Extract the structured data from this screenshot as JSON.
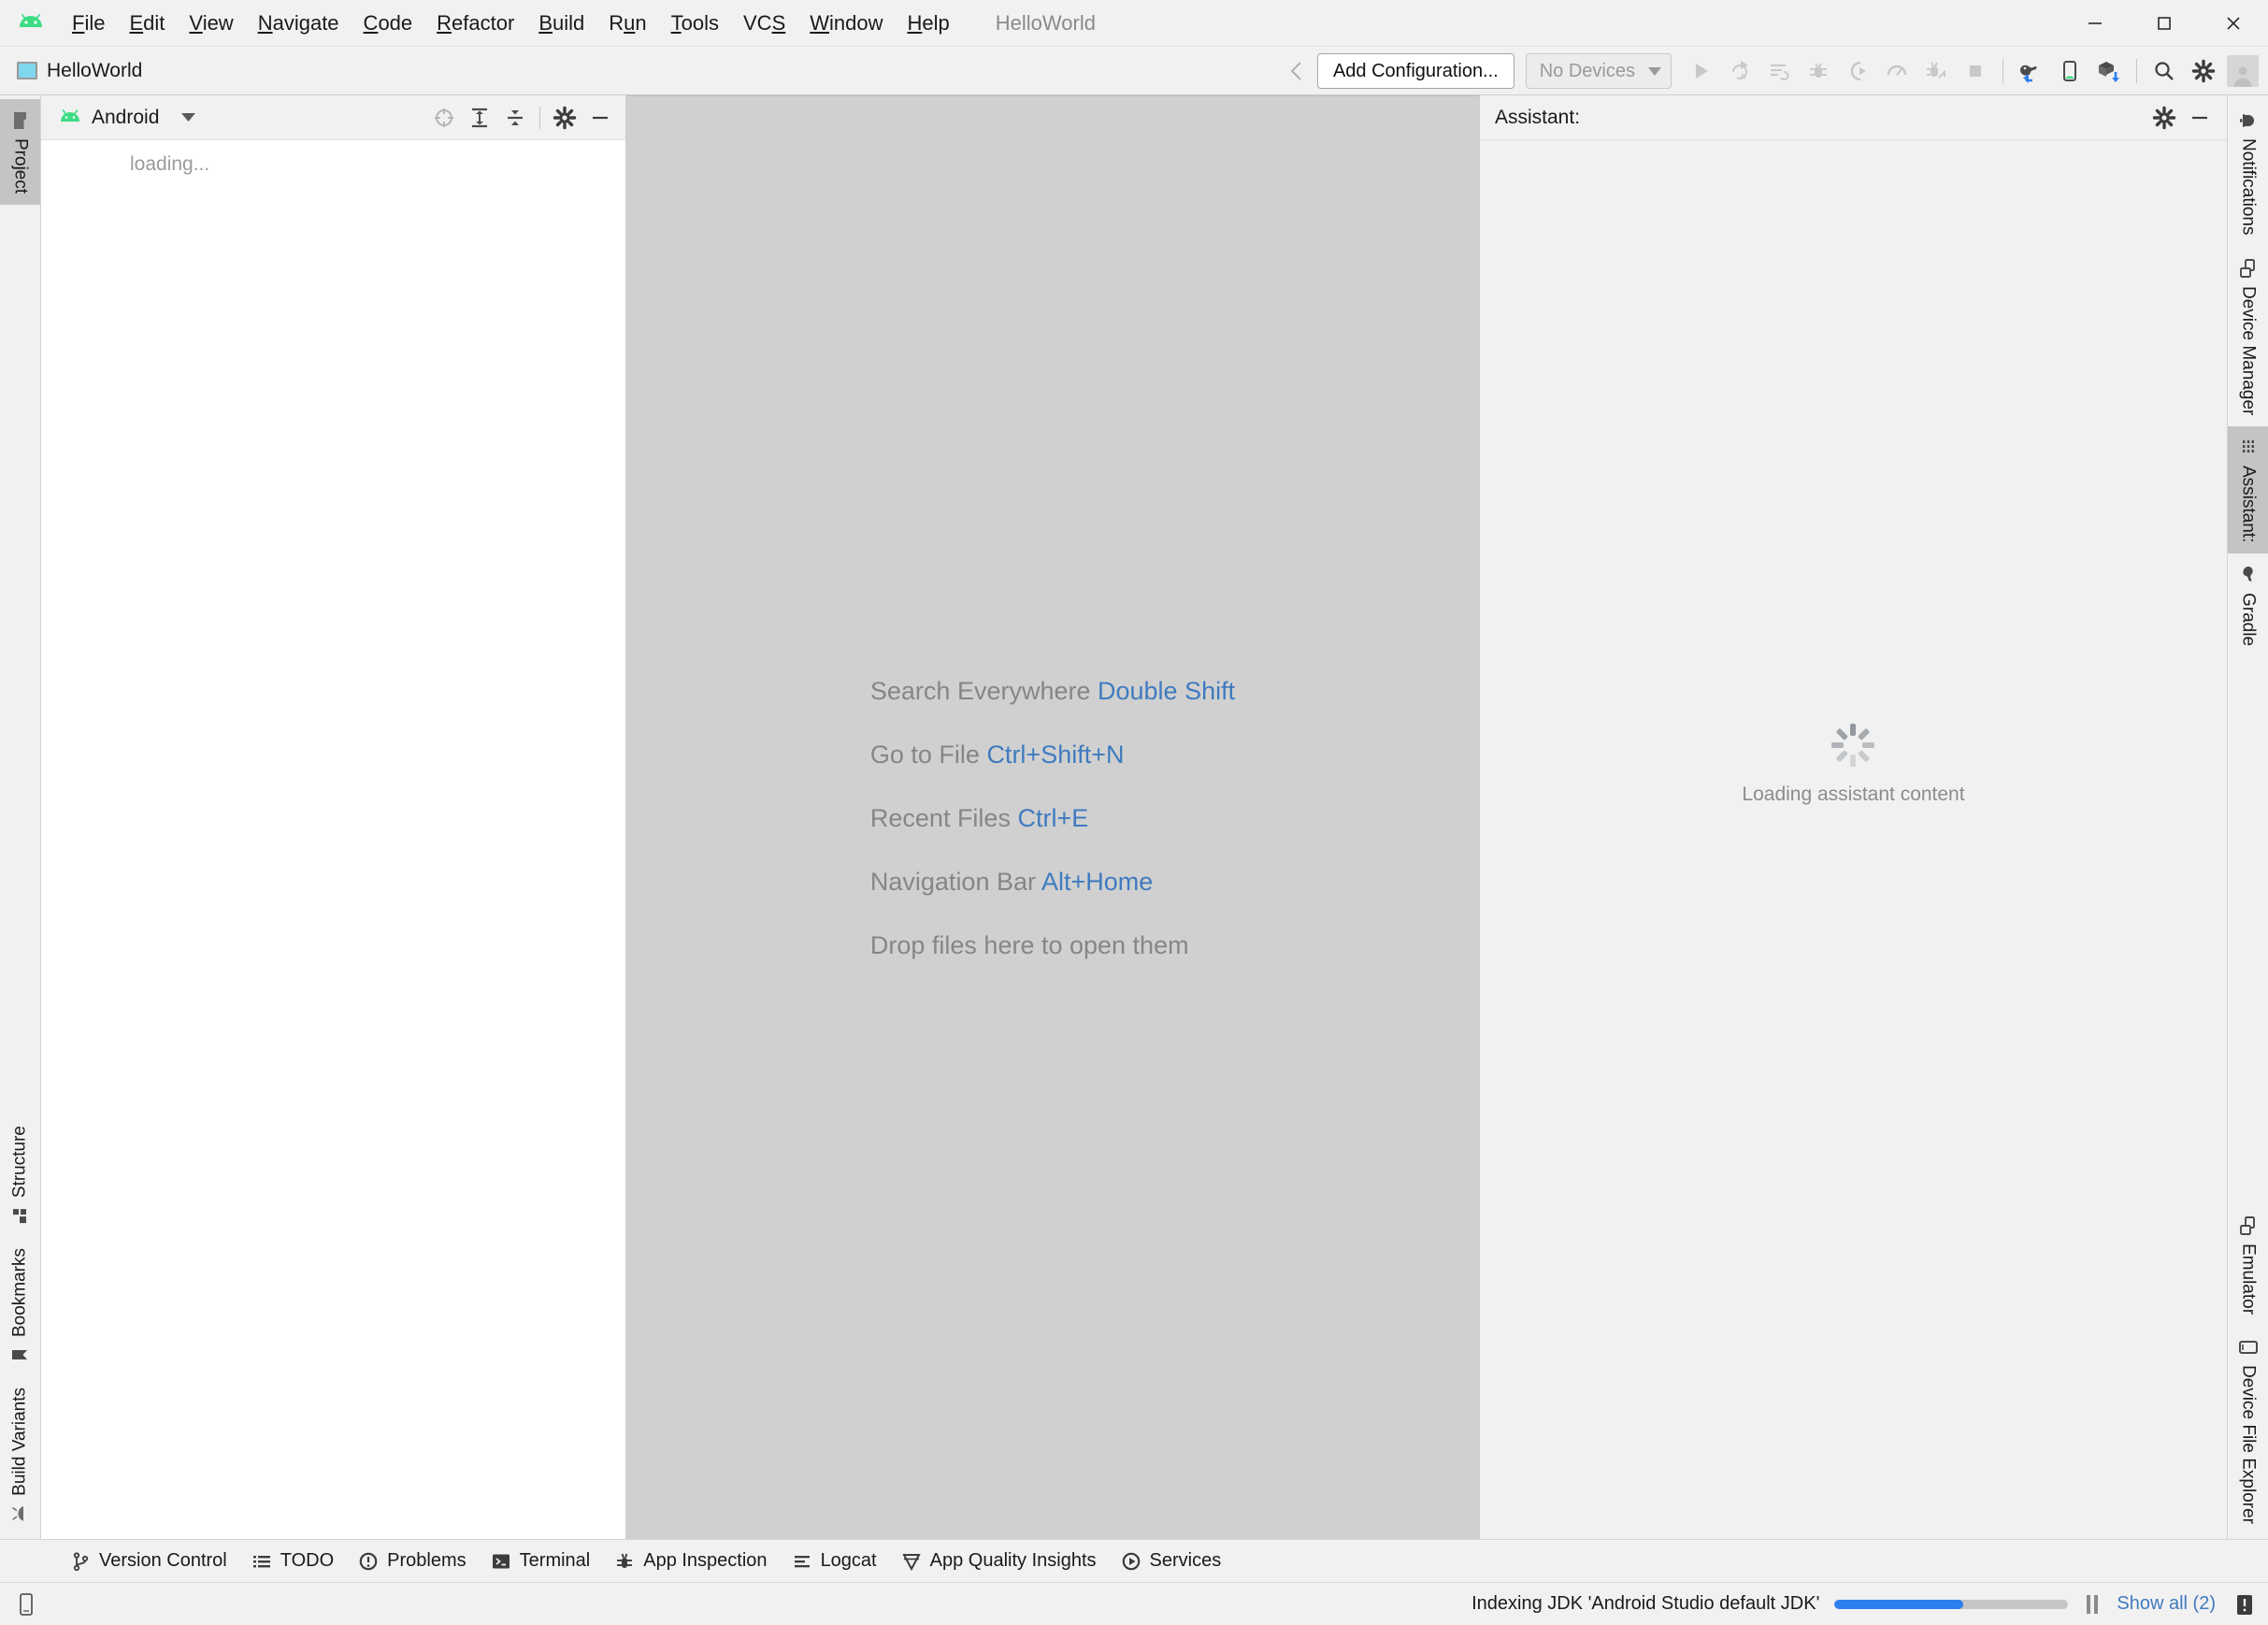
{
  "window": {
    "project_title": "HelloWorld",
    "logo": "android-logo-icon",
    "controls": {
      "minimize": "minimize-icon",
      "maximize": "maximize-icon",
      "close": "close-icon"
    }
  },
  "menu": [
    {
      "label": "File",
      "mnemonic": "F"
    },
    {
      "label": "Edit",
      "mnemonic": "E"
    },
    {
      "label": "View",
      "mnemonic": "V"
    },
    {
      "label": "Navigate",
      "mnemonic": "N"
    },
    {
      "label": "Code",
      "mnemonic": "C"
    },
    {
      "label": "Refactor",
      "mnemonic": "R"
    },
    {
      "label": "Build",
      "mnemonic": "B"
    },
    {
      "label": "Run",
      "mnemonic": "u"
    },
    {
      "label": "Tools",
      "mnemonic": "T"
    },
    {
      "label": "VCS",
      "mnemonic": "S"
    },
    {
      "label": "Window",
      "mnemonic": "W"
    },
    {
      "label": "Help",
      "mnemonic": "H"
    }
  ],
  "toolbar": {
    "module_label": "HelloWorld",
    "add_configuration_label": "Add Configuration...",
    "devices_label": "No Devices",
    "devices_caret": "chevron-down-icon",
    "back_arrow": "navigate-back-icon",
    "run_icons": [
      {
        "name": "run-icon",
        "enabled": false
      },
      {
        "name": "apply-code-changes-icon",
        "enabled": false
      },
      {
        "name": "apply-changes-restart-icon",
        "enabled": false
      },
      {
        "name": "debug-icon",
        "enabled": false
      },
      {
        "name": "run-with-coverage-icon",
        "enabled": false
      },
      {
        "name": "profiler-icon",
        "enabled": false
      },
      {
        "name": "attach-debugger-icon",
        "enabled": false
      },
      {
        "name": "stop-icon",
        "enabled": false
      }
    ],
    "right_icons": [
      {
        "name": "gradle-sync-icon"
      },
      {
        "name": "avd-manager-icon"
      },
      {
        "name": "sdk-manager-icon"
      },
      {
        "name": "search-icon"
      },
      {
        "name": "settings-gear-icon"
      },
      {
        "name": "user-avatar-icon"
      }
    ]
  },
  "left_strip": {
    "top": [
      {
        "label": "Project",
        "icon": "folder-icon",
        "active": true
      }
    ],
    "bottom": [
      {
        "label": "Structure",
        "icon": "structure-icon",
        "active": false
      },
      {
        "label": "Bookmarks",
        "icon": "bookmark-icon",
        "active": false
      },
      {
        "label": "Build Variants",
        "icon": "android-variant-icon",
        "active": false
      }
    ]
  },
  "project_panel": {
    "view_label": "Android",
    "view_icon": "android-head-icon",
    "view_caret": "chevron-down-icon",
    "actions": [
      {
        "name": "select-opened-file-icon"
      },
      {
        "name": "expand-all-icon"
      },
      {
        "name": "collapse-all-icon"
      },
      {
        "name": "settings-gear-icon"
      },
      {
        "name": "hide-icon"
      }
    ],
    "content_text": "loading..."
  },
  "editor": {
    "hints": [
      {
        "action": "Search Everywhere",
        "shortcut": "Double Shift"
      },
      {
        "action": "Go to File",
        "shortcut": "Ctrl+Shift+N"
      },
      {
        "action": "Recent Files",
        "shortcut": "Ctrl+E"
      },
      {
        "action": "Navigation Bar",
        "shortcut": "Alt+Home"
      }
    ],
    "drop_text": "Drop files here to open them",
    "background_color": "#d0d0d0",
    "hint_color": "#868686",
    "shortcut_color": "#3f7bbf"
  },
  "assistant": {
    "title": "Assistant:",
    "loading_text": "Loading assistant content",
    "actions": [
      {
        "name": "settings-gear-icon"
      },
      {
        "name": "hide-icon"
      }
    ]
  },
  "right_strip": {
    "top": [
      {
        "label": "Notifications",
        "icon": "bell-icon",
        "active": false
      },
      {
        "label": "Device Manager",
        "icon": "device-manager-icon",
        "active": false
      },
      {
        "label": "Assistant:",
        "icon": "assistant-list-icon",
        "active": true
      },
      {
        "label": "Gradle",
        "icon": "gradle-elephant-icon",
        "active": false
      }
    ],
    "bottom": [
      {
        "label": "Emulator",
        "icon": "emulator-icon",
        "active": false
      },
      {
        "label": "Device File Explorer",
        "icon": "device-file-explorer-icon",
        "active": false
      }
    ]
  },
  "bottom_bar": [
    {
      "label": "Version Control",
      "icon": "version-control-icon"
    },
    {
      "label": "TODO",
      "icon": "todo-list-icon"
    },
    {
      "label": "Problems",
      "icon": "problems-icon"
    },
    {
      "label": "Terminal",
      "icon": "terminal-icon"
    },
    {
      "label": "App Inspection",
      "icon": "app-inspection-icon"
    },
    {
      "label": "Logcat",
      "icon": "logcat-icon"
    },
    {
      "label": "App Quality Insights",
      "icon": "app-quality-insights-icon"
    },
    {
      "label": "Services",
      "icon": "services-icon"
    }
  ],
  "status_bar": {
    "left_icon": "device-toggle-icon",
    "indexing_text": "Indexing JDK 'Android Studio default JDK'",
    "progress_percent": 55,
    "progress_color": "#2d7ff0",
    "pause_icon": "pause-icon",
    "show_all_label": "Show all (2)",
    "notification_icon": "notification-warning-icon"
  }
}
